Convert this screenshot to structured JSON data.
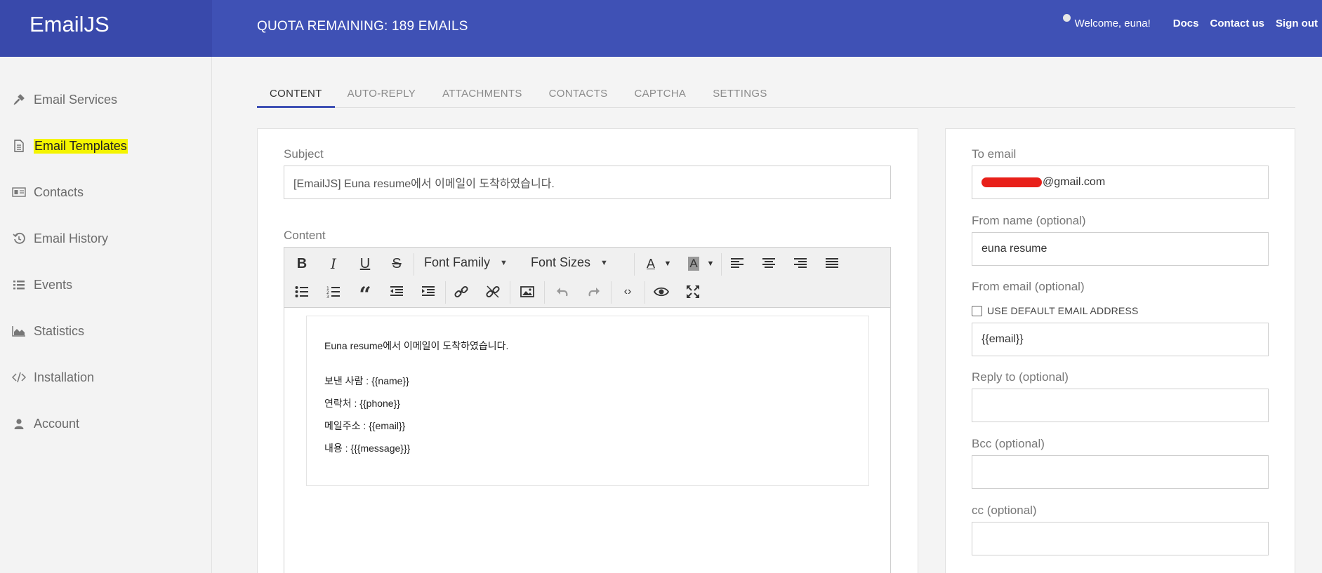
{
  "header": {
    "brand": "EmailJS",
    "quota": "QUOTA REMAINING: 189 EMAILS",
    "welcome": "Welcome, euna!",
    "links": [
      "Docs",
      "Contact us",
      "Sign out"
    ],
    "bg_color": "#3f51b5"
  },
  "sidebar": {
    "items": [
      {
        "label": "Email Services",
        "icon": "plug-icon"
      },
      {
        "label": "Email Templates",
        "icon": "document-icon",
        "active": true
      },
      {
        "label": "Contacts",
        "icon": "contact-card-icon"
      },
      {
        "label": "Email History",
        "icon": "history-icon"
      },
      {
        "label": "Events",
        "icon": "list-icon"
      },
      {
        "label": "Statistics",
        "icon": "area-chart-icon"
      },
      {
        "label": "Installation",
        "icon": "code-icon"
      },
      {
        "label": "Account",
        "icon": "user-icon"
      }
    ]
  },
  "tabs": [
    "CONTENT",
    "AUTO-REPLY",
    "ATTACHMENTS",
    "CONTACTS",
    "CAPTCHA",
    "SETTINGS"
  ],
  "active_tab": "CONTENT",
  "content": {
    "subject_label": "Subject",
    "subject_value": "[EmailJS] Euna resume에서 이메일이 도착하였습니다.",
    "content_label": "Content",
    "toolbar": {
      "font_family": "Font Family",
      "font_sizes": "Font Sizes"
    },
    "body_lines": [
      "Euna resume에서 이메일이 도착하였습니다.",
      "보낸 사람 : {{name}}",
      "연락처 : {{phone}}",
      "메일주소 : {{email}}",
      "내용 : {{{message}}}"
    ]
  },
  "settings": {
    "to_email_label": "To email",
    "to_email_value": "@gmail.com",
    "from_name_label": "From name (optional)",
    "from_name_value": "euna resume",
    "from_email_label": "From email (optional)",
    "use_default_label": "USE DEFAULT EMAIL ADDRESS",
    "from_email_value": "{{email}}",
    "reply_to_label": "Reply to (optional)",
    "bcc_label": "Bcc (optional)",
    "cc_label": "cc (optional)"
  }
}
